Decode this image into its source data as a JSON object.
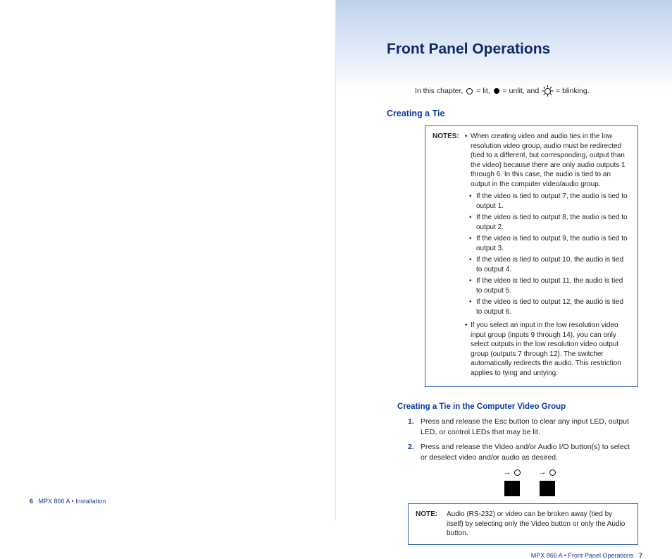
{
  "left_footer": {
    "num": "6",
    "text": "MPX 866 A • Installation"
  },
  "right_footer": {
    "text": "MPX 866 A • Front Panel Operations",
    "num": "7"
  },
  "title": "Front Panel Operations",
  "legend": {
    "p1": "In this chapter, ",
    "p2": " = lit, ",
    "p3": " = unlit, and ",
    "p4": " = blinking."
  },
  "h2": "Creating a Tie",
  "notes1": {
    "label": "NOTES:",
    "intro": "When creating video and audio ties in the low resolution video group, audio must be redirected (tied to a different, but corresponding, output than the video) because there are only audio outputs 1 through 6. In this case, the audio is tied to an output in the computer video/audio group.",
    "items": [
      "If the video is tied to output 7, the audio is tied to output 1.",
      "If the video is tied to output 8, the audio is tied to output 2.",
      "If the video is tied to output 9, the audio is tied to output 3.",
      "If the video is tied to output 10, the audio is tied to output 4.",
      "If the video is tied to output 11, the audio is tied to output 5.",
      "If the video is tied to output 12, the audio is tied to output 6."
    ],
    "outro": "If you select an input in the low resolution video input group (inputs 9 through 14), you can only select outputs in the low resolution video output group (outputs 7 through 12). The switcher automatically redirects the audio. This restriction applies to tying and untying."
  },
  "h3": "Creating a Tie in the Computer Video Group",
  "steps": [
    "Press and release the Esc button to clear any input LED, output LED, or control LEDs that may be lit.",
    "Press and release the Video and/or Audio I/O button(s) to select or deselect video and/or audio as desired."
  ],
  "notes2": {
    "label": "NOTE:",
    "text": "Audio (RS-232) or video can be broken away (tied by itself) by selecting only the Video button or only the Audio button."
  }
}
